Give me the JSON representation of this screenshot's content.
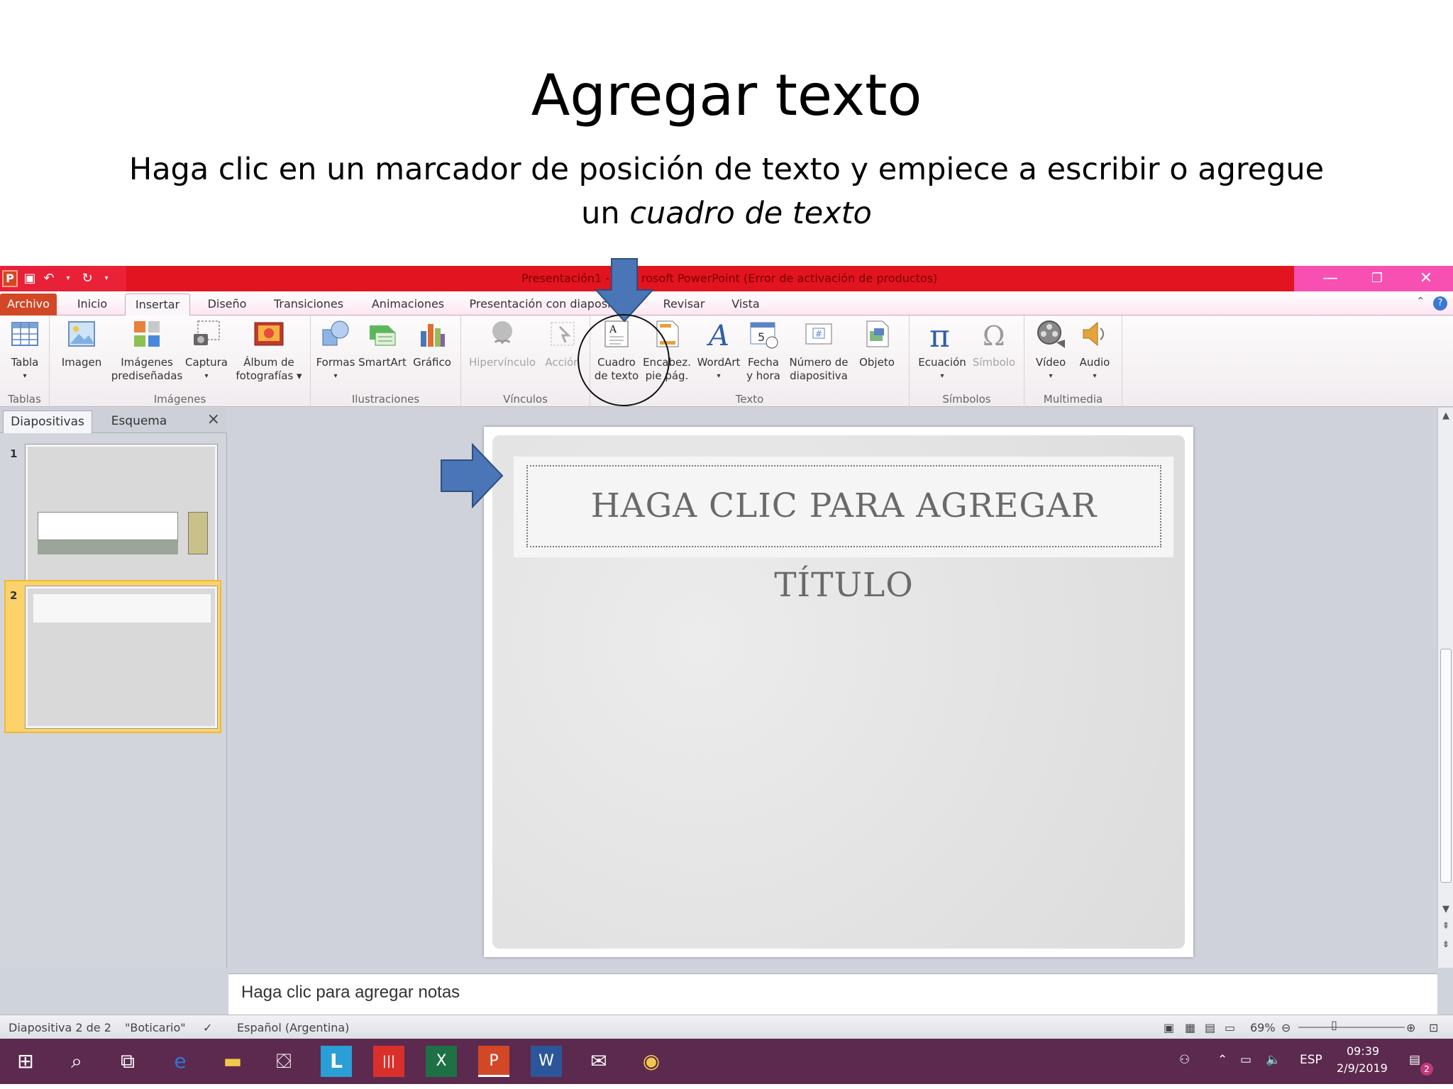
{
  "slide": {
    "title": "Agregar texto",
    "subtitle_line1": "Haga clic en un marcador de posición de texto y empiece a escribir o agregue",
    "subtitle_line2_prefix": "un ",
    "subtitle_line2_italic": "cuadro de texto"
  },
  "window": {
    "title": "Presentación1 - Microsoft PowerPoint (Error de activación de productos)",
    "title_left": "Presentación1 -",
    "title_right": "rosoft PowerPoint (Error de activación de productos)"
  },
  "tabs": [
    "Archivo",
    "Inicio",
    "Insertar",
    "Diseño",
    "Transiciones",
    "Animaciones",
    "Presentación con diapositivas",
    "Revisar",
    "Vista"
  ],
  "tab_labels": {
    "archivo": "Archivo",
    "inicio": "Inicio",
    "insertar": "Insertar",
    "diseno": "Diseño",
    "transiciones": "Transiciones",
    "animaciones": "Animaciones",
    "presentacion": "Presentación con diaposi",
    "revisar": "Revisar",
    "vista": "Vista"
  },
  "ribbon": {
    "tablas": {
      "label": "Tablas",
      "tabla": "Tabla"
    },
    "imagenes": {
      "label": "Imágenes",
      "imagen": "Imagen",
      "prediseñadas_1": "Imágenes",
      "prediseñadas_2": "prediseñadas",
      "captura": "Captura",
      "album_1": "Álbum de",
      "album_2": "fotografías"
    },
    "ilustraciones": {
      "label": "Ilustraciones",
      "formas": "Formas",
      "smartart": "SmartArt",
      "grafico": "Gráfico"
    },
    "vinculos": {
      "label": "Vínculos",
      "hipervinculo": "Hipervínculo",
      "accion": "Acción"
    },
    "texto": {
      "label": "Texto",
      "cuadro_1": "Cuadro",
      "cuadro_2": "de texto",
      "encab_1": "Encabez.",
      "encab_2": "pie pág.",
      "wordart": "WordArt",
      "fecha_1": "Fecha",
      "fecha_2": "y hora",
      "numero_1": "Número de",
      "numero_2": "diapositiva",
      "objeto": "Objeto"
    },
    "simbolos": {
      "label": "Símbolos",
      "ecuacion": "Ecuación",
      "simbolo": "Símbolo"
    },
    "multimedia": {
      "label": "Multimedia",
      "video": "Vídeo",
      "audio": "Audio"
    }
  },
  "left_pane": {
    "tab_diapositivas": "Diapositivas",
    "tab_esquema": "Esquema",
    "close": "×",
    "thumb1_num": "1",
    "thumb2_num": "2"
  },
  "editor": {
    "title_placeholder": "HAGA CLIC PARA AGREGAR TÍTULO",
    "notes_placeholder": "Haga clic para agregar notas"
  },
  "status": {
    "slide_info": "Diapositiva 2 de 2",
    "theme": "\"Boticario\"",
    "language": "Español (Argentina)",
    "zoom": "69%"
  },
  "taskbar": {
    "lang": "ESP",
    "time": "09:39",
    "date": "2/9/2019",
    "notifications": "2"
  },
  "colors": {
    "accent_arrow": "#4a76b8",
    "title_bar": "#e2141f",
    "taskbar": "#5c2a4e",
    "file_tab": "#d24726"
  }
}
